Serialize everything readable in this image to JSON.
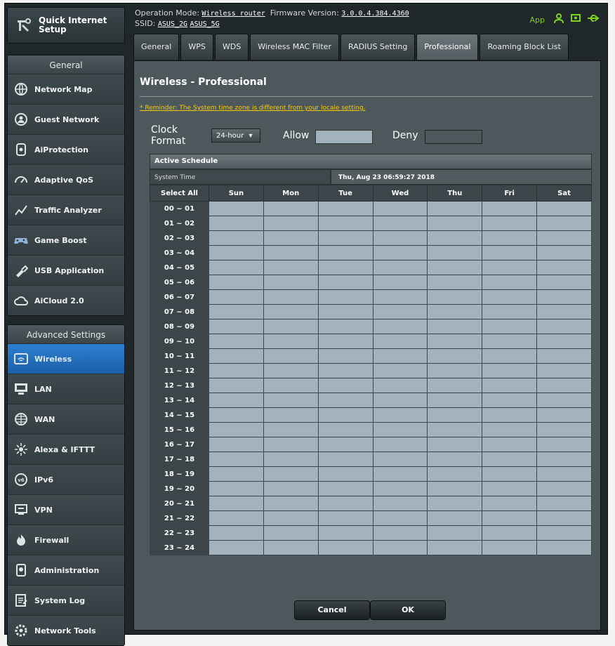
{
  "header": {
    "op_mode_label": "Operation Mode:",
    "op_mode_value": "Wireless router",
    "firmware_label": "Firmware Version:",
    "firmware_value": "3.0.0.4.384.4360",
    "ssid_label": "SSID:",
    "ssid_24": "ASUS_2G",
    "ssid_5": "ASUS_5G",
    "app_label": "App"
  },
  "sidebar": {
    "quick_setup": "Quick Internet Setup",
    "general_header": "General",
    "general_items": [
      {
        "label": "Network Map",
        "icon": "network-map-icon"
      },
      {
        "label": "Guest Network",
        "icon": "guest-network-icon"
      },
      {
        "label": "AiProtection",
        "icon": "aiprotection-icon"
      },
      {
        "label": "Adaptive QoS",
        "icon": "adaptive-qos-icon"
      },
      {
        "label": "Traffic Analyzer",
        "icon": "traffic-analyzer-icon"
      },
      {
        "label": "Game Boost",
        "icon": "game-boost-icon"
      },
      {
        "label": "USB Application",
        "icon": "usb-application-icon"
      },
      {
        "label": "AiCloud 2.0",
        "icon": "aicloud-icon"
      }
    ],
    "advanced_header": "Advanced Settings",
    "advanced_items": [
      {
        "label": "Wireless",
        "icon": "wireless-icon",
        "active": true
      },
      {
        "label": "LAN",
        "icon": "lan-icon"
      },
      {
        "label": "WAN",
        "icon": "wan-icon"
      },
      {
        "label": "Alexa & IFTTT",
        "icon": "alexa-icon"
      },
      {
        "label": "IPv6",
        "icon": "ipv6-icon"
      },
      {
        "label": "VPN",
        "icon": "vpn-icon"
      },
      {
        "label": "Firewall",
        "icon": "firewall-icon"
      },
      {
        "label": "Administration",
        "icon": "administration-icon"
      },
      {
        "label": "System Log",
        "icon": "system-log-icon"
      },
      {
        "label": "Network Tools",
        "icon": "network-tools-icon"
      }
    ]
  },
  "tabs": [
    {
      "label": "General"
    },
    {
      "label": "WPS"
    },
    {
      "label": "WDS"
    },
    {
      "label": "Wireless MAC Filter"
    },
    {
      "label": "RADIUS Setting"
    },
    {
      "label": "Professional",
      "active": true
    },
    {
      "label": "Roaming Block List"
    }
  ],
  "page": {
    "title": "Wireless - Professional",
    "reminder": "* Reminder: The System time zone is different from your locale setting.",
    "clock_format_label": "Clock Format",
    "clock_format_value": "24-hour",
    "allow_label": "Allow",
    "deny_label": "Deny",
    "colors": {
      "allow": "#a3b3bd",
      "deny": "#4d585c",
      "accent": "#1d6fc0"
    },
    "schedule": {
      "title": "Active Schedule",
      "system_time_label": "System Time",
      "system_time_value": "Thu, Aug 23 06:59:27 2018",
      "select_all": "Select All",
      "days": [
        "Sun",
        "Mon",
        "Tue",
        "Wed",
        "Thu",
        "Fri",
        "Sat"
      ],
      "hours": [
        "00 ~ 01",
        "01 ~ 02",
        "02 ~ 03",
        "03 ~ 04",
        "04 ~ 05",
        "05 ~ 06",
        "06 ~ 07",
        "07 ~ 08",
        "08 ~ 09",
        "09 ~ 10",
        "10 ~ 11",
        "11 ~ 12",
        "12 ~ 13",
        "13 ~ 14",
        "14 ~ 15",
        "15 ~ 16",
        "16 ~ 17",
        "17 ~ 18",
        "18 ~ 19",
        "19 ~ 20",
        "20 ~ 21",
        "21 ~ 22",
        "22 ~ 23",
        "23 ~ 24"
      ],
      "all_allowed": true
    },
    "cancel_label": "Cancel",
    "ok_label": "OK"
  }
}
